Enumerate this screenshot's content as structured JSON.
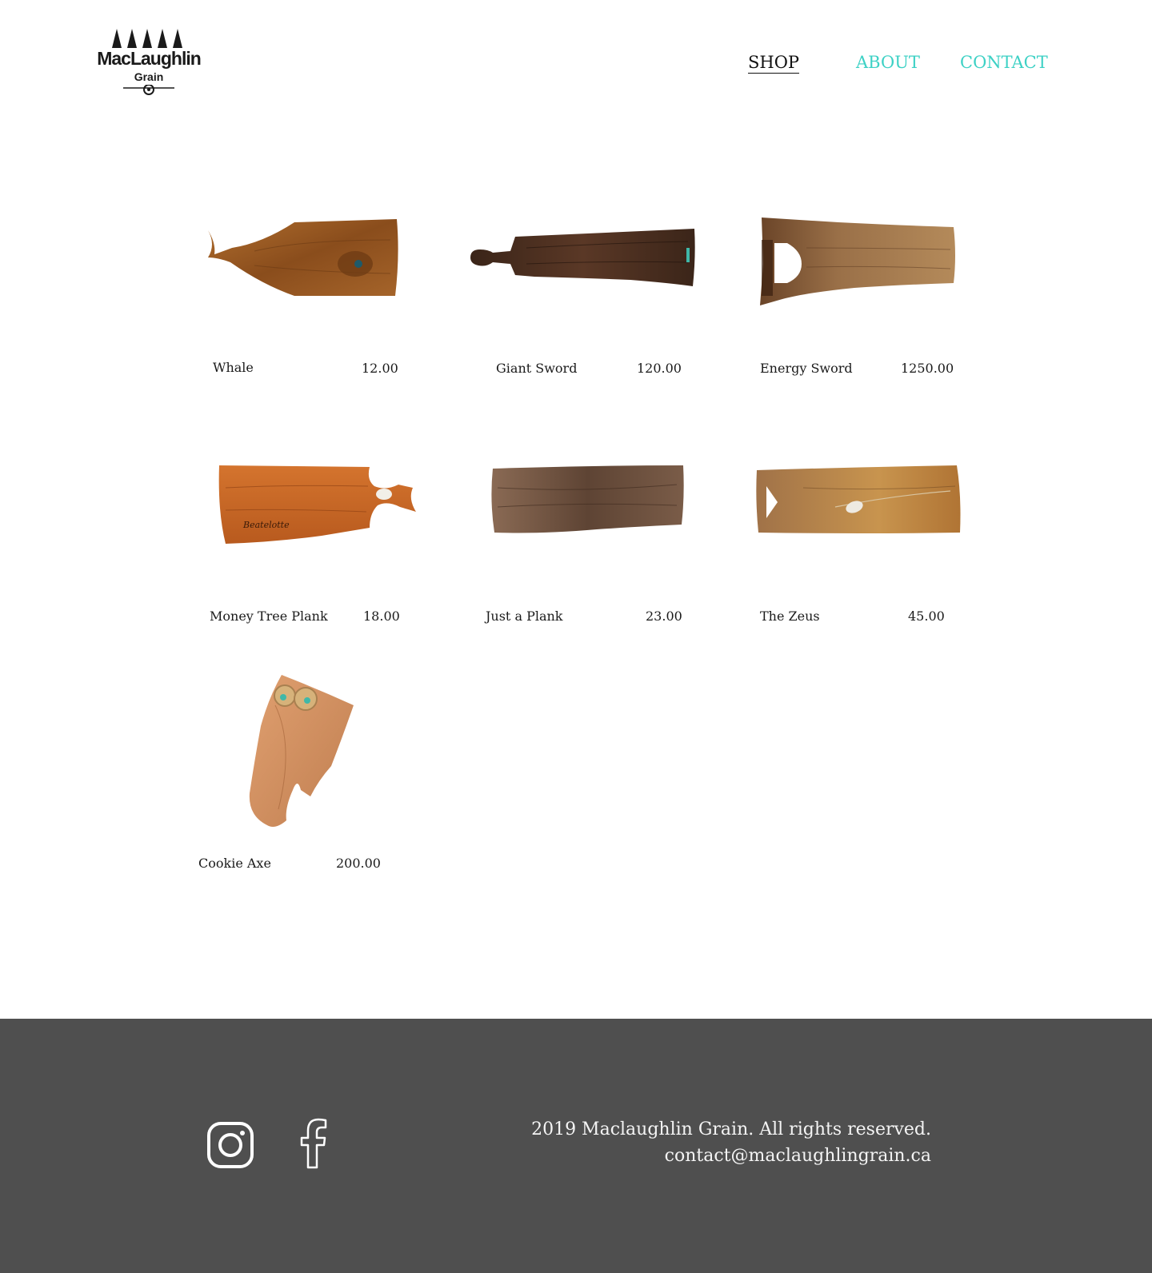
{
  "header": {
    "logo_name": "MacLaughlin",
    "logo_sub": "Grain",
    "nav": [
      {
        "label": "SHOP"
      },
      {
        "label": "ABOUT"
      },
      {
        "label": "CONTACT"
      }
    ]
  },
  "products": [
    {
      "name": "Whale",
      "price": "12.00"
    },
    {
      "name": "Giant Sword",
      "price": "120.00"
    },
    {
      "name": "Energy Sword",
      "price": "1250.00"
    },
    {
      "name": "Money Tree Plank",
      "price": "18.00"
    },
    {
      "name": "Just a Plank",
      "price": "23.00"
    },
    {
      "name": "The Zeus",
      "price": "45.00"
    },
    {
      "name": "Cookie Axe",
      "price": "200.00"
    }
  ],
  "footer": {
    "copyright": "2019 Maclaughlin Grain. All rights reserved.",
    "email": "contact@maclaughlingrain.ca",
    "social": [
      "instagram-icon",
      "facebook-icon"
    ]
  },
  "colors": {
    "accent": "#3dd1c5",
    "footer_bg": "#4f4f4f"
  }
}
